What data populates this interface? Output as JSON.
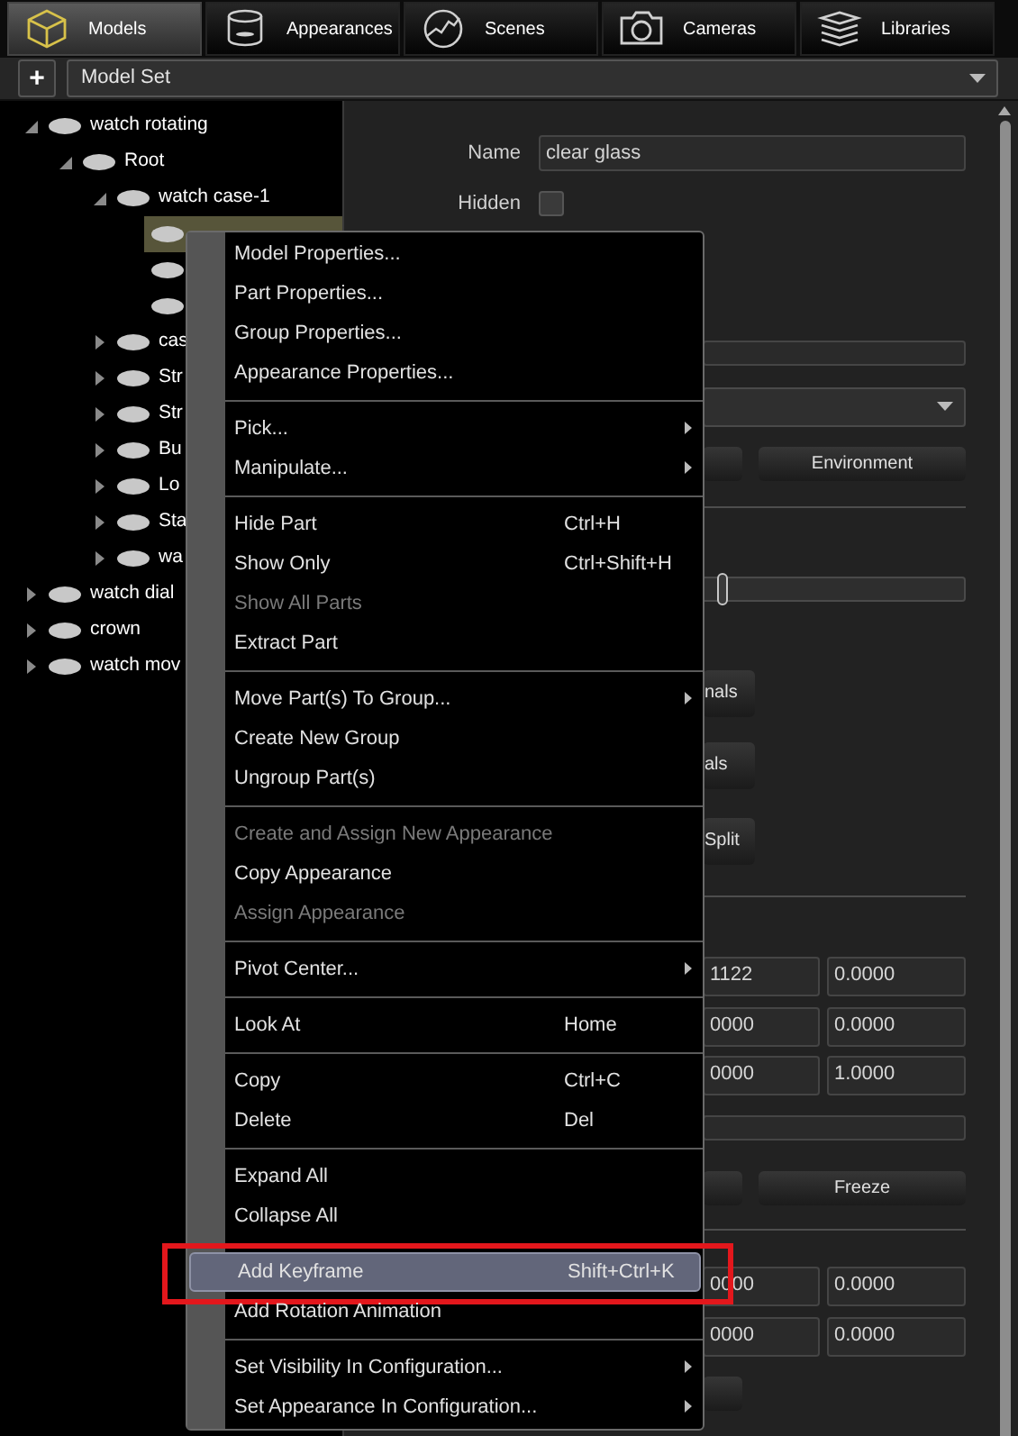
{
  "tabs": [
    {
      "label": "Models",
      "selected": true
    },
    {
      "label": "Appearances",
      "selected": false
    },
    {
      "label": "Scenes",
      "selected": false
    },
    {
      "label": "Cameras",
      "selected": false
    },
    {
      "label": "Libraries",
      "selected": false
    }
  ],
  "toolbar": {
    "add_button": "+",
    "model_set": "Model Set"
  },
  "tree": [
    {
      "label": "watch rotating",
      "expanded": true,
      "selected": false,
      "children": [
        {
          "label": "Root",
          "expanded": true,
          "selected": false,
          "children": [
            {
              "label": "watch case-1",
              "expanded": true,
              "selected": false,
              "children": [
                {
                  "selected": true
                },
                {
                  "selected": false
                },
                {
                  "selected": false
                }
              ]
            },
            {
              "label": "cas",
              "expanded": false,
              "selected": false
            },
            {
              "label": "Str",
              "expanded": false,
              "selected": false
            },
            {
              "label": "Str",
              "expanded": false,
              "selected": false
            },
            {
              "label": "Bu",
              "expanded": false,
              "selected": false
            },
            {
              "label": "Lo",
              "expanded": false,
              "selected": false
            },
            {
              "label": "Sta",
              "expanded": false,
              "selected": false
            },
            {
              "label": "wa",
              "expanded": false,
              "selected": false
            }
          ]
        }
      ]
    },
    {
      "label": "watch dial",
      "expanded": false,
      "selected": false
    },
    {
      "label": "crown",
      "expanded": false,
      "selected": false
    },
    {
      "label": "watch mov",
      "expanded": false,
      "selected": false
    }
  ],
  "properties": [
    {
      "kind": "text",
      "label": "Name",
      "value": "clear glass"
    },
    {
      "kind": "checkbox",
      "label": "Hidden",
      "checked": false
    },
    {
      "kind": "field"
    },
    {
      "kind": "dropdown"
    },
    {
      "kind": "button_pair",
      "right": "Environment"
    },
    {
      "kind": "divider"
    },
    {
      "kind": "slider",
      "level": 0.43
    },
    {
      "kind": "button",
      "label": "nals"
    },
    {
      "kind": "button",
      "label": "als"
    },
    {
      "kind": "button",
      "label": "Split"
    },
    {
      "kind": "divider"
    },
    {
      "kind": "pair",
      "values": [
        "1122",
        "0.0000"
      ]
    },
    {
      "kind": "pair",
      "values": [
        "0000",
        "0.0000"
      ]
    },
    {
      "kind": "pair",
      "values": [
        "0000",
        "1.0000"
      ]
    },
    {
      "kind": "field"
    },
    {
      "kind": "button_pair",
      "right": "Freeze"
    },
    {
      "kind": "divider"
    },
    {
      "kind": "pair",
      "values": [
        "0000",
        "0.0000"
      ]
    },
    {
      "kind": "pair",
      "values": [
        "0000",
        "0.0000"
      ]
    },
    {
      "kind": "small_button"
    }
  ],
  "menu": [
    {
      "kind": "item",
      "label": "Model Properties...",
      "disabled": false,
      "submenu": false,
      "selected": false,
      "annotated": false
    },
    {
      "kind": "item",
      "label": "Part Properties...",
      "disabled": false,
      "submenu": false,
      "selected": false,
      "annotated": false
    },
    {
      "kind": "item",
      "label": "Group Properties...",
      "disabled": false,
      "submenu": false,
      "selected": false,
      "annotated": false
    },
    {
      "kind": "item",
      "label": "Appearance Properties...",
      "disabled": false,
      "submenu": false,
      "selected": false,
      "annotated": false
    },
    {
      "kind": "separator"
    },
    {
      "kind": "item",
      "label": "Pick...",
      "disabled": false,
      "submenu": true,
      "selected": false,
      "annotated": false
    },
    {
      "kind": "item",
      "label": "Manipulate...",
      "disabled": false,
      "submenu": true,
      "selected": false,
      "annotated": false
    },
    {
      "kind": "separator"
    },
    {
      "kind": "item",
      "label": "Hide Part",
      "shortcut": "Ctrl+H",
      "disabled": false,
      "submenu": false,
      "selected": false,
      "annotated": false
    },
    {
      "kind": "item",
      "label": "Show Only",
      "shortcut": "Ctrl+Shift+H",
      "disabled": false,
      "submenu": false,
      "selected": false,
      "annotated": false
    },
    {
      "kind": "item",
      "label": "Show All Parts",
      "disabled": true,
      "submenu": false,
      "selected": false,
      "annotated": false
    },
    {
      "kind": "item",
      "label": "Extract Part",
      "disabled": false,
      "submenu": false,
      "selected": false,
      "annotated": false
    },
    {
      "kind": "separator"
    },
    {
      "kind": "item",
      "label": "Move Part(s) To Group...",
      "disabled": false,
      "submenu": true,
      "selected": false,
      "annotated": false
    },
    {
      "kind": "item",
      "label": "Create New Group",
      "disabled": false,
      "submenu": false,
      "selected": false,
      "annotated": false
    },
    {
      "kind": "item",
      "label": "Ungroup Part(s)",
      "disabled": false,
      "submenu": false,
      "selected": false,
      "annotated": false
    },
    {
      "kind": "separator"
    },
    {
      "kind": "item",
      "label": "Create and Assign New Appearance",
      "disabled": true,
      "submenu": false,
      "selected": false,
      "annotated": false
    },
    {
      "kind": "item",
      "label": "Copy Appearance",
      "disabled": false,
      "submenu": false,
      "selected": false,
      "annotated": false
    },
    {
      "kind": "item",
      "label": "Assign Appearance",
      "disabled": true,
      "submenu": false,
      "selected": false,
      "annotated": false
    },
    {
      "kind": "separator"
    },
    {
      "kind": "item",
      "label": "Pivot Center...",
      "disabled": false,
      "submenu": true,
      "selected": false,
      "annotated": false
    },
    {
      "kind": "separator"
    },
    {
      "kind": "item",
      "label": "Look At",
      "shortcut": "Home",
      "disabled": false,
      "submenu": false,
      "selected": false,
      "annotated": false
    },
    {
      "kind": "separator"
    },
    {
      "kind": "item",
      "label": "Copy",
      "shortcut": "Ctrl+C",
      "disabled": false,
      "submenu": false,
      "selected": false,
      "annotated": false
    },
    {
      "kind": "item",
      "label": "Delete",
      "shortcut": "Del",
      "disabled": false,
      "submenu": false,
      "selected": false,
      "annotated": false
    },
    {
      "kind": "separator"
    },
    {
      "kind": "item",
      "label": "Expand All",
      "disabled": false,
      "submenu": false,
      "selected": false,
      "annotated": false
    },
    {
      "kind": "item",
      "label": "Collapse All",
      "disabled": false,
      "submenu": false,
      "selected": false,
      "annotated": false
    },
    {
      "kind": "separator"
    },
    {
      "kind": "item",
      "label": "Add Keyframe",
      "shortcut": "Shift+Ctrl+K",
      "disabled": false,
      "submenu": false,
      "selected": true,
      "annotated": true
    },
    {
      "kind": "item",
      "label": "Add Rotation Animation",
      "disabled": false,
      "submenu": false,
      "selected": false,
      "annotated": false
    },
    {
      "kind": "separator"
    },
    {
      "kind": "item",
      "label": "Set Visibility In Configuration...",
      "disabled": false,
      "submenu": true,
      "selected": false,
      "annotated": false
    },
    {
      "kind": "item",
      "label": "Set Appearance In Configuration...",
      "disabled": false,
      "submenu": true,
      "selected": false,
      "annotated": false
    }
  ]
}
